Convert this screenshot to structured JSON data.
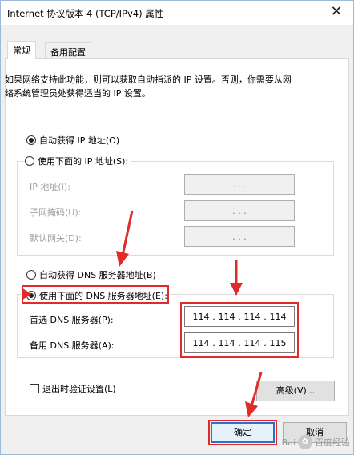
{
  "window": {
    "title": "Internet 协议版本 4 (TCP/IPv4) 属性",
    "close_glyph": "✕"
  },
  "tabs": [
    {
      "label": "常规",
      "active": true
    },
    {
      "label": "备用配置",
      "active": false
    }
  ],
  "description": "如果网络支持此功能，则可以获取自动指派的 IP 设置。否则，你需要从网\n络系统管理员处获得适当的 IP 设置。",
  "ip_section": {
    "auto_label": "自动获得 IP 地址(O)",
    "auto_checked": true,
    "manual_label": "使用下面的 IP 地址(S):",
    "manual_checked": false,
    "fields": [
      {
        "label": "IP 地址(I):",
        "value": ". . ."
      },
      {
        "label": "子网掩码(U):",
        "value": ". . ."
      },
      {
        "label": "默认网关(D):",
        "value": ". . ."
      }
    ]
  },
  "dns_section": {
    "auto_label": "自动获得 DNS 服务器地址(B)",
    "auto_checked": false,
    "manual_label": "使用下面的 DNS 服务器地址(E):",
    "manual_checked": true,
    "preferred_label": "首选 DNS 服务器(P):",
    "preferred_octets": [
      "114",
      "114",
      "114",
      "114"
    ],
    "alternate_label": "备用 DNS 服务器(A):",
    "alternate_octets": [
      "114",
      "114",
      "114",
      "115"
    ]
  },
  "validate_label": "退出时验证设置(L)",
  "validate_checked": false,
  "advanced_label": "高级(V)...",
  "ok_label": "确定",
  "cancel_label": "取消",
  "watermark": {
    "brand": "Bai",
    "text": "百度经验"
  },
  "annotation_color": "#e12a2a",
  "accent_color": "#2b72c8"
}
